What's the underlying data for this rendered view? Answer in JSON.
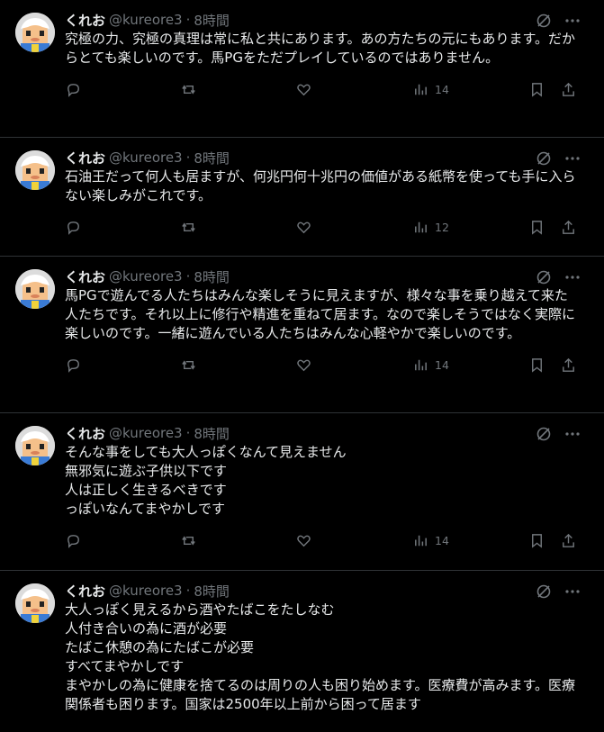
{
  "tweets": [
    {
      "name": "くれお",
      "handle": "@kureore3",
      "time": "8時間",
      "text": "究極の力、究極の真理は常に私と共にあります。あの方たちの元にもあります。だからとても楽しいのです。馬PGをただプレイしているのではありません。",
      "views": "14"
    },
    {
      "name": "くれお",
      "handle": "@kureore3",
      "time": "8時間",
      "text": "石油王だって何人も居ますが、何兆円何十兆円の価値がある紙幣を使っても手に入らない楽しみがこれです。",
      "views": "12"
    },
    {
      "name": "くれお",
      "handle": "@kureore3",
      "time": "8時間",
      "text": "馬PGで遊んでる人たちはみんな楽しそうに見えますが、様々な事を乗り越えて来た人たちです。それ以上に修行や精進を重ねて居ます。なので楽しそうではなく実際に楽しいのです。一緒に遊んでいる人たちはみんな心軽やかで楽しいのです。",
      "views": "14"
    },
    {
      "name": "くれお",
      "handle": "@kureore3",
      "time": "8時間",
      "text": "そんな事をしても大人っぽくなんて見えません\n無邪気に遊ぶ子供以下です\n人は正しく生きるべきです\nっぽいなんてまやかしです",
      "views": "14"
    },
    {
      "name": "くれお",
      "handle": "@kureore3",
      "time": "8時間",
      "text": "大人っぽく見えるから酒やたばこをたしなむ\n人付き合いの為に酒が必要\nたばこ休憩の為にたばこが必要\nすべてまやかしです\nまやかしの為に健康を捨てるのは周りの人も困り始めます。医療費が高みます。医療関係者も困ります。国家は2500年以上前から困って居ます",
      "views": ""
    }
  ],
  "colors": {
    "bg": "#000000",
    "text": "#e7e9ea",
    "muted": "#71767b",
    "border": "#2f3336"
  }
}
